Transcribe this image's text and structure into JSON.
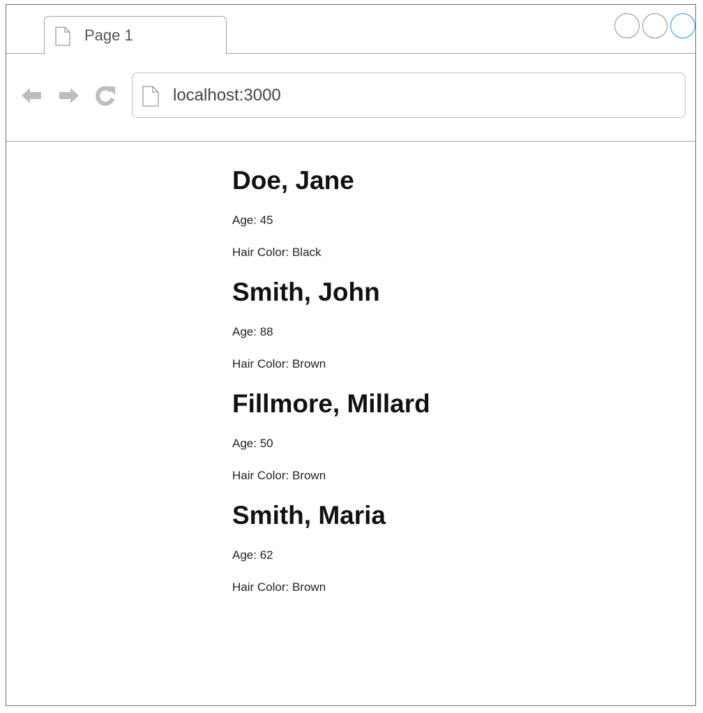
{
  "browser": {
    "tab_title": "Page 1",
    "address": "localhost:3000",
    "icons": {
      "tab": "document-icon",
      "address": "document-icon",
      "back": "arrow-left-icon",
      "forward": "arrow-right-icon",
      "reload": "reload-icon"
    },
    "window_controls": [
      "minimize",
      "restore",
      "maximize"
    ],
    "colors": {
      "maximize_accent": "#1e90ff",
      "nav_icon": "#bdbdbd",
      "border": "#a3a3a3"
    }
  },
  "people": [
    {
      "name": "Doe, Jane",
      "age": "Age: 45",
      "hair": "Hair Color: Black"
    },
    {
      "name": "Smith, John",
      "age": "Age: 88",
      "hair": "Hair Color: Brown"
    },
    {
      "name": "Fillmore, Millard",
      "age": "Age: 50",
      "hair": "Hair Color: Brown"
    },
    {
      "name": "Smith, Maria",
      "age": "Age: 62",
      "hair": "Hair Color: Brown"
    }
  ]
}
